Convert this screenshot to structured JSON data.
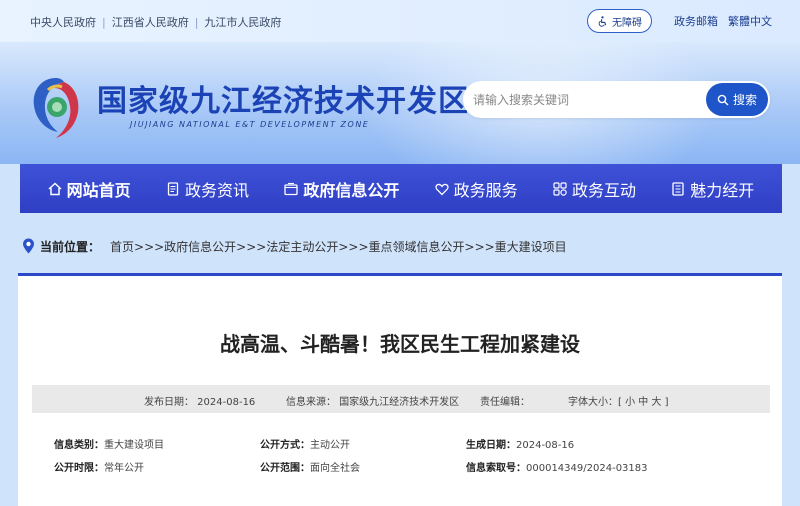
{
  "topbar": {
    "links": [
      "中央人民政府",
      "江西省人民政府",
      "九江市人民政府"
    ],
    "accessibility_label": "无障碍",
    "mail_label": "政务邮箱",
    "traditional_label": "繁體中文"
  },
  "header": {
    "site_title": "国家级九江经济技术开发区",
    "site_subtitle": "JIUJIANG NATIONAL E&T DEVELOPMENT ZONE",
    "search_placeholder": "请输入搜索关键词",
    "search_button": "搜索"
  },
  "nav": {
    "items": [
      {
        "label": "网站首页",
        "icon": "home-icon"
      },
      {
        "label": "政务资讯",
        "icon": "document-icon"
      },
      {
        "label": "政府信息公开",
        "icon": "folder-icon"
      },
      {
        "label": "政务服务",
        "icon": "heart-icon"
      },
      {
        "label": "政务互动",
        "icon": "interaction-icon"
      },
      {
        "label": "魅力经开",
        "icon": "list-icon"
      }
    ]
  },
  "breadcrumb": {
    "label": "当前位置：",
    "trail": "首页>>>政府信息公开>>>法定主动公开>>>重点领域信息公开>>>重大建设项目"
  },
  "article": {
    "title": "战高温、斗酷暑！我区民生工程加紧建设",
    "meta": {
      "date": "发布日期：  2024-08-16",
      "source": "信息来源：  国家级九江经济技术开发区",
      "editor": "责任编辑：",
      "font_size": "字体大小：[ 小  中  大 ]"
    },
    "info": {
      "category_key": "信息类别：",
      "category_val": "重大建设项目",
      "method_key": "公开方式：",
      "method_val": "主动公开",
      "date_key": "生成日期：",
      "date_val": "2024-08-16",
      "period_key": "公开时限：",
      "period_val": "常年公开",
      "scope_key": "公开范围：",
      "scope_val": "面向全社会",
      "index_key": "信息索取号：",
      "index_val": "000014349/2024-03183"
    }
  },
  "colors": {
    "nav_bg": "#3447cf",
    "title_blue": "#1b43b5",
    "search_button": "#1e56c9"
  }
}
